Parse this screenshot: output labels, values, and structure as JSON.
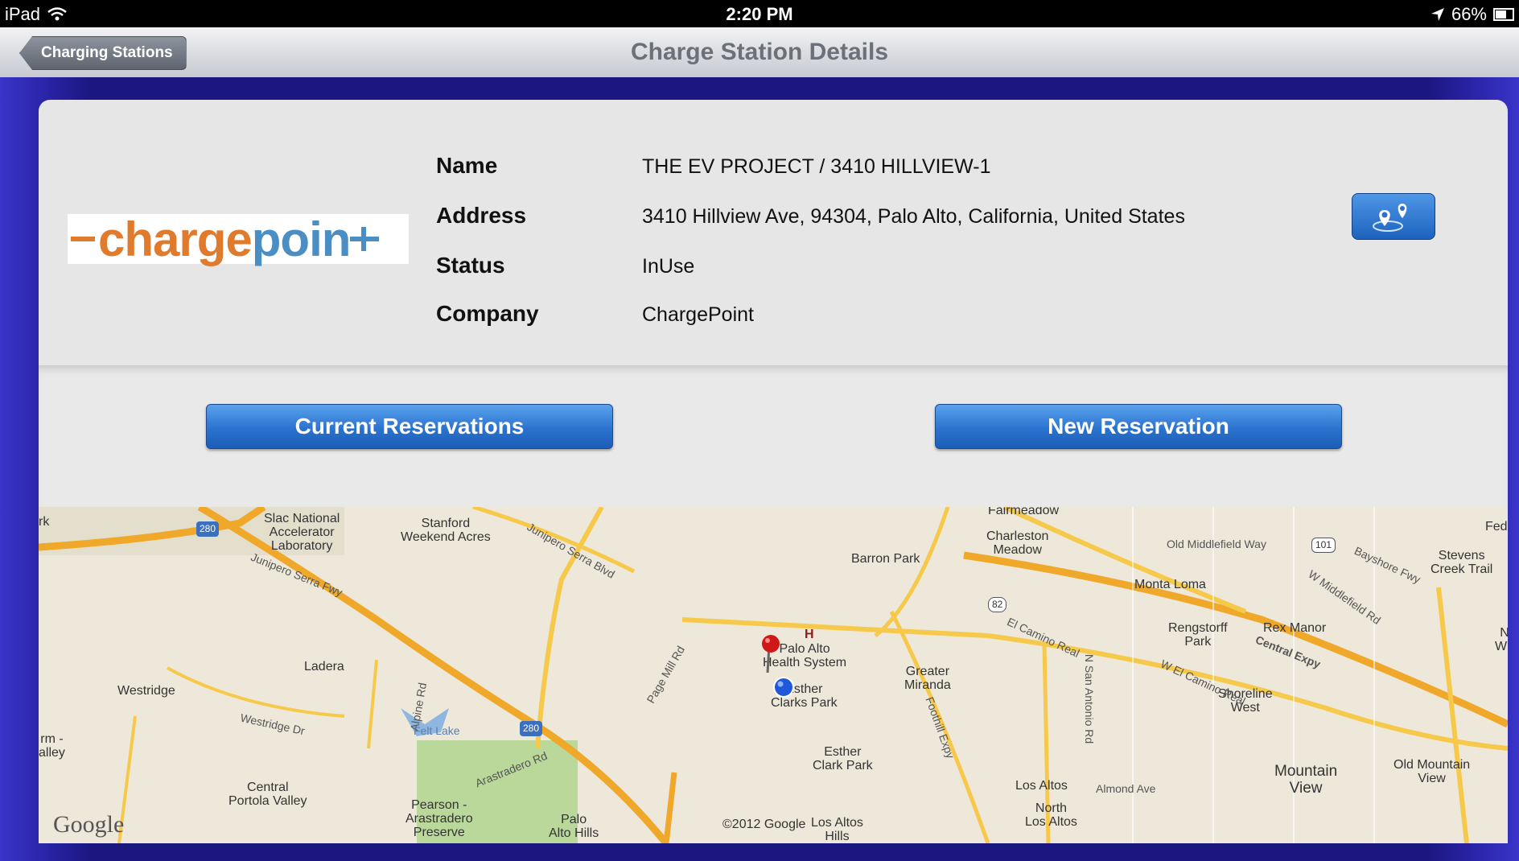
{
  "statusbar": {
    "device": "iPad",
    "time": "2:20 PM",
    "battery": "66%"
  },
  "navbar": {
    "back_label": "Charging Stations",
    "title": "Charge Station Details"
  },
  "logo": {
    "text_a": "charge",
    "text_b": "poin"
  },
  "details": {
    "name_label": "Name",
    "name_value": "THE EV PROJECT / 3410 HILLVIEW-1",
    "address_label": "Address",
    "address_value": "3410 Hillview Ave, 94304, Palo Alto, California, United States",
    "status_label": "Status",
    "status_value": "InUse",
    "company_label": "Company",
    "company_value": "ChargePoint"
  },
  "buttons": {
    "current": "Current Reservations",
    "new": "New Reservation"
  },
  "map": {
    "google": "Google",
    "labels": [
      "Slac National",
      "Accelerator",
      "Laboratory",
      "Stanford",
      "Weekend Acres",
      "Fairmeadow",
      "Charleston",
      "Meadow",
      "Barron Park",
      "Old Middlefield Way",
      "101",
      "Stevens",
      "Creek Trail",
      "Monta Loma",
      "Rengstorff",
      "Park",
      "Rex Manor",
      "H",
      "Palo Alto",
      "Health System",
      "Greater",
      "Miranda",
      "Esther",
      "Clarks Park",
      "Shoreline",
      "West",
      "Ladera",
      "Westridge",
      "Esther",
      "Clark Park",
      "Mountain",
      "View",
      "Old Mountain",
      "View",
      "Central",
      "Portola Valley",
      "Pearson -",
      "Arastradero",
      "Preserve",
      "Palo",
      "Alto Hills",
      "©2012 Google",
      "Los Altos",
      "Hills",
      "Los Altos",
      "Almond Ave",
      "North",
      "Los Altos",
      "Junipero Serra Fwy",
      "Junipero Serra Blvd",
      "Page Mill Rd",
      "Arastradero Rd",
      "El Camino Real",
      "W El Camino Real",
      "Central Expy",
      "Bayshore Fwy",
      "W Middlefield Rd",
      "Foothill Expy",
      "N San Antonio Rd",
      "Westridge Dr",
      "Alpine Rd",
      "Felt Lake",
      "280",
      "82",
      "Fed",
      "rk",
      "rm -",
      "alley",
      "N",
      "Wh"
    ]
  }
}
